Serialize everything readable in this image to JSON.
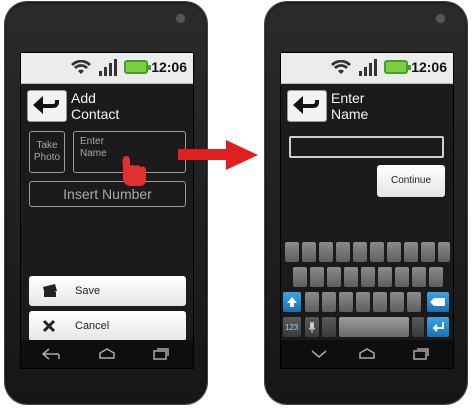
{
  "status": {
    "time": "12:06"
  },
  "left_screen": {
    "title": "Add\nContact",
    "photo_label": "Take\nPhoto",
    "name_placeholder": "Enter\nName",
    "number_placeholder": "Insert Number",
    "save_label": "Save",
    "cancel_label": "Cancel"
  },
  "right_screen": {
    "title": "Enter\nName",
    "continue_label": "Continue",
    "keyboard_mode_label": "123"
  },
  "colors": {
    "arrow": "#e02020",
    "battery": "#7ccf3e",
    "hand": "#e23030"
  }
}
